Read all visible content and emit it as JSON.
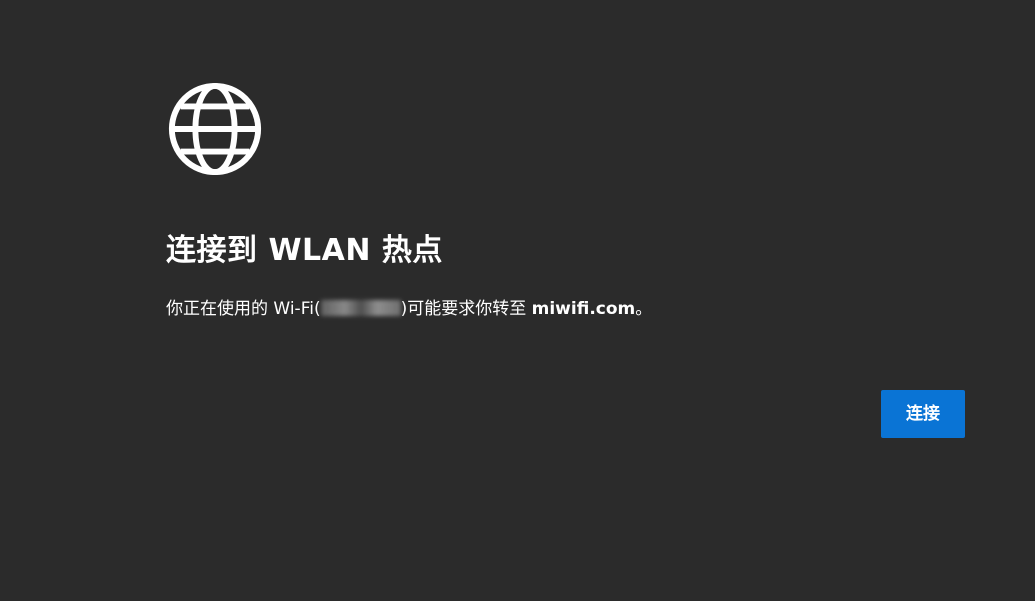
{
  "dialog": {
    "icon": "globe-icon",
    "title": "连接到 WLAN 热点",
    "message_prefix": "你正在使用的 Wi-Fi(",
    "message_middle": ")可能要求你转至 ",
    "message_host": "miwifi.com",
    "message_suffix": "。",
    "connect_label": "连接",
    "accent_color": "#0a74d5",
    "background_color": "#2b2b2b"
  }
}
